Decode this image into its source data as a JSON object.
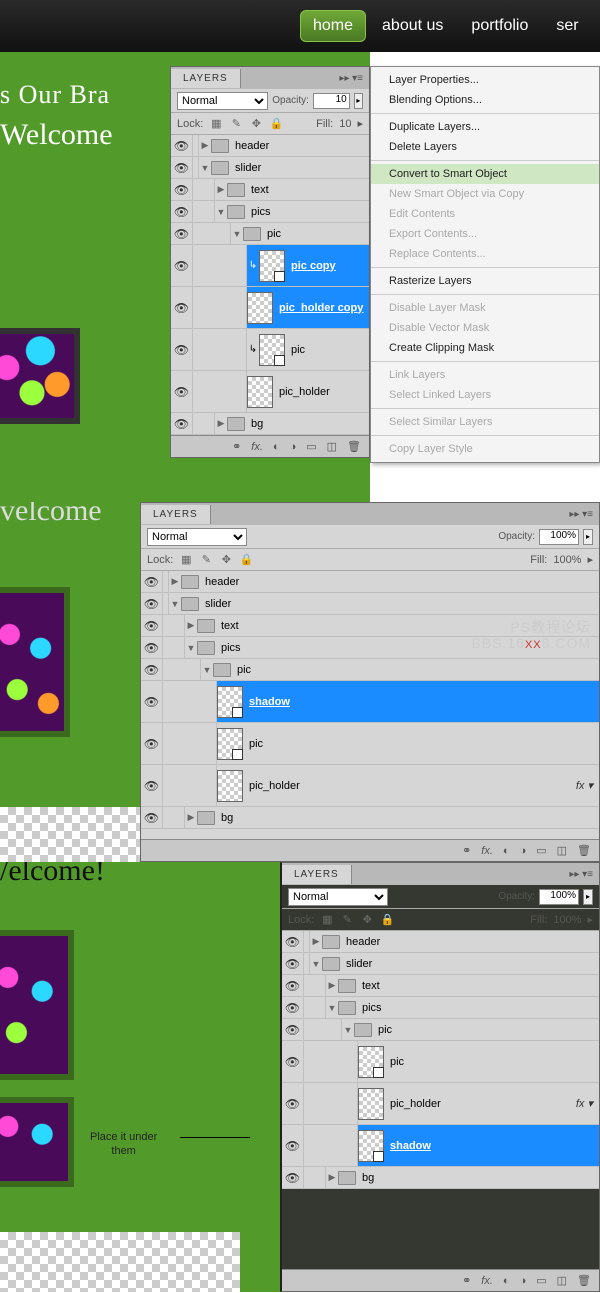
{
  "nav": {
    "items": [
      "home",
      "about us",
      "portfolio",
      "ser"
    ],
    "active": 0
  },
  "canvas": {
    "headline": "s Our Bra",
    "welcome": "Welcome",
    "welcome2": "velcome",
    "welcome3": "/elcome!"
  },
  "annotation": "Place it under\nthem",
  "watermark": {
    "l1": "PS教程论坛",
    "l2a": "BBS.16",
    "l2x": "XX",
    "l2b": "8.COM"
  },
  "panel_labels": {
    "tab": "LAYERS",
    "blend": "Normal",
    "opacity": "Opacity:",
    "fill": "Fill:",
    "lock": "Lock:",
    "pct100": "100%",
    "pct10": "10"
  },
  "layers1": [
    {
      "t": "folder",
      "name": "header",
      "ind": 0,
      "exp": false
    },
    {
      "t": "folder",
      "name": "slider",
      "ind": 0,
      "exp": true
    },
    {
      "t": "folder",
      "name": "text",
      "ind": 1,
      "exp": false
    },
    {
      "t": "folder",
      "name": "pics",
      "ind": 1,
      "exp": true
    },
    {
      "t": "folder",
      "name": "pic",
      "ind": 2,
      "exp": true
    },
    {
      "t": "layer",
      "name": "pic copy",
      "ind": 3,
      "sel": true,
      "smart": true,
      "link": true
    },
    {
      "t": "layer",
      "name": "pic_holder copy",
      "ind": 3,
      "sel": true
    },
    {
      "t": "layer",
      "name": "pic",
      "ind": 3,
      "smart": true,
      "link": true
    },
    {
      "t": "layer",
      "name": "pic_holder",
      "ind": 3
    },
    {
      "t": "folder",
      "name": "bg",
      "ind": 1,
      "exp": false
    }
  ],
  "layers2": [
    {
      "t": "folder",
      "name": "header",
      "ind": 0,
      "exp": false
    },
    {
      "t": "folder",
      "name": "slider",
      "ind": 0,
      "exp": true
    },
    {
      "t": "folder",
      "name": "text",
      "ind": 1,
      "exp": false
    },
    {
      "t": "folder",
      "name": "pics",
      "ind": 1,
      "exp": true
    },
    {
      "t": "folder",
      "name": "pic",
      "ind": 2,
      "exp": true
    },
    {
      "t": "layer",
      "name": "shadow",
      "ind": 3,
      "sel": true,
      "smart": true
    },
    {
      "t": "layer",
      "name": "pic",
      "ind": 3,
      "smart": true
    },
    {
      "t": "layer",
      "name": "pic_holder",
      "ind": 3,
      "fx": true
    },
    {
      "t": "folder",
      "name": "bg",
      "ind": 1,
      "exp": false
    }
  ],
  "layers3": [
    {
      "t": "folder",
      "name": "header",
      "ind": 0,
      "exp": false
    },
    {
      "t": "folder",
      "name": "slider",
      "ind": 0,
      "exp": true
    },
    {
      "t": "folder",
      "name": "text",
      "ind": 1,
      "exp": false
    },
    {
      "t": "folder",
      "name": "pics",
      "ind": 1,
      "exp": true
    },
    {
      "t": "folder",
      "name": "pic",
      "ind": 2,
      "exp": true
    },
    {
      "t": "layer",
      "name": "pic",
      "ind": 3,
      "smart": true
    },
    {
      "t": "layer",
      "name": "pic_holder",
      "ind": 3,
      "fx": true
    },
    {
      "t": "layer",
      "name": "shadow",
      "ind": 3,
      "sel": true,
      "smart": true
    },
    {
      "t": "folder",
      "name": "bg",
      "ind": 1,
      "exp": false
    }
  ],
  "context_menu": [
    {
      "label": "Layer Properties..."
    },
    {
      "label": "Blending Options..."
    },
    {
      "sep": true
    },
    {
      "label": "Duplicate Layers..."
    },
    {
      "label": "Delete Layers"
    },
    {
      "sep": true
    },
    {
      "label": "Convert to Smart Object",
      "hov": true
    },
    {
      "label": "New Smart Object via Copy",
      "dis": true
    },
    {
      "label": "Edit Contents",
      "dis": true
    },
    {
      "label": "Export Contents...",
      "dis": true
    },
    {
      "label": "Replace Contents...",
      "dis": true
    },
    {
      "sep": true
    },
    {
      "label": "Rasterize Layers"
    },
    {
      "sep": true
    },
    {
      "label": "Disable Layer Mask",
      "dis": true
    },
    {
      "label": "Disable Vector Mask",
      "dis": true
    },
    {
      "label": "Create Clipping Mask"
    },
    {
      "sep": true
    },
    {
      "label": "Link Layers",
      "dis": true
    },
    {
      "label": "Select Linked Layers",
      "dis": true
    },
    {
      "sep": true
    },
    {
      "label": "Select Similar Layers",
      "dis": true
    },
    {
      "sep": true
    },
    {
      "label": "Copy Layer Style",
      "dis": true
    }
  ]
}
